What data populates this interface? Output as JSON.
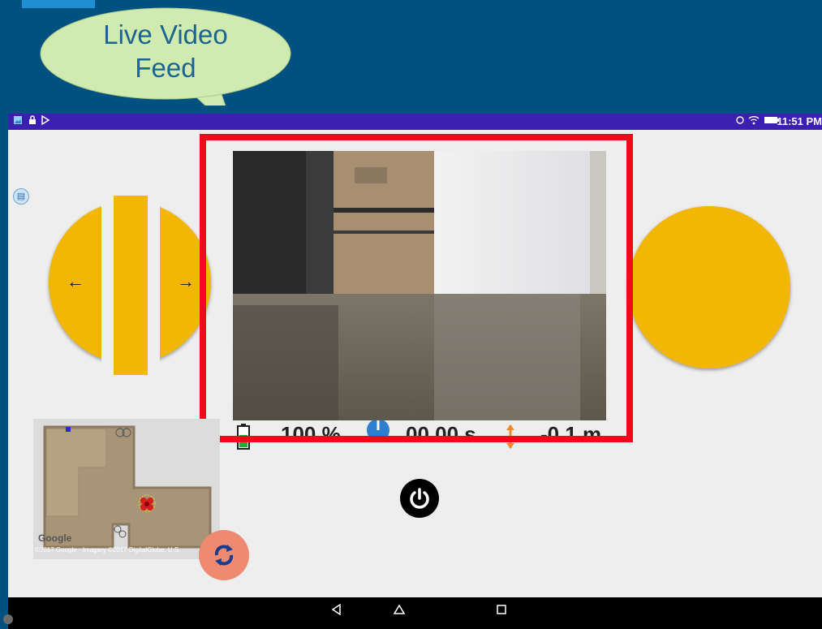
{
  "annotation": {
    "callout_text": "Live Video Feed",
    "highlight_color": "#f2081b"
  },
  "status_bar": {
    "left_icons": [
      "gallery-icon",
      "lock-icon",
      "play-store-icon"
    ],
    "right_icons": [
      "sync-icon",
      "wifi-icon",
      "battery-icon"
    ],
    "time": "11:51 PM"
  },
  "telemetry": {
    "battery": "100 %",
    "timer": "00.00 s",
    "altitude": "-0.1 m"
  },
  "minimap": {
    "logo": "Google",
    "copyright": "©2017 Google · Imagery ©2017 DigitalGlobe, U.S."
  },
  "controls": {
    "left_joystick_arrows": [
      "←",
      "→"
    ],
    "power_button": "power-icon",
    "refresh_button": "refresh-icon"
  },
  "nav_bar": {
    "buttons": [
      "back",
      "home",
      "recent"
    ]
  },
  "colors": {
    "background": "#00517f",
    "joystick": "#f2b705",
    "status_bar": "#3a1fb0",
    "callout_fill": "#d0ebb0",
    "refresh": "#ef8a72"
  }
}
